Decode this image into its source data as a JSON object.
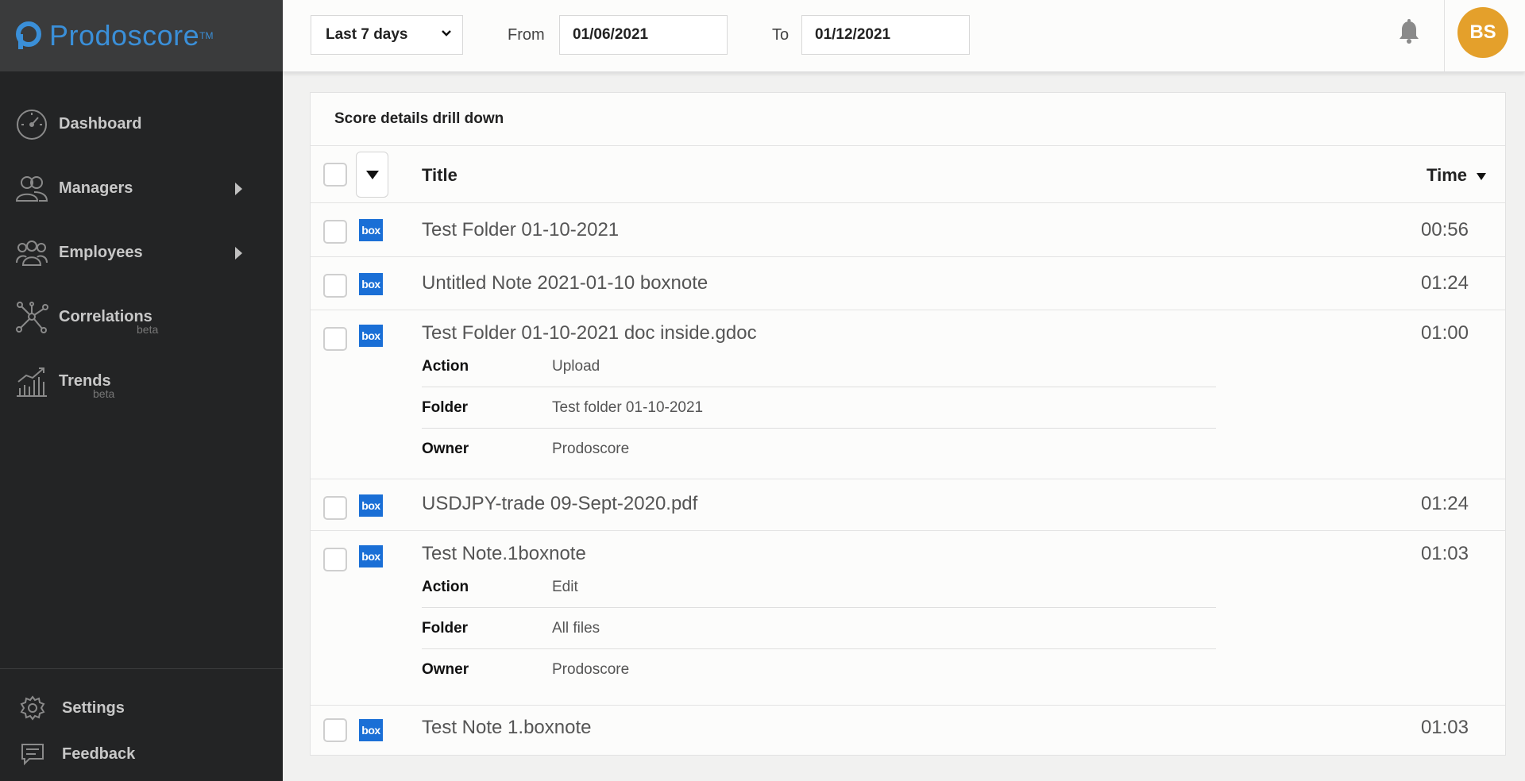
{
  "app": {
    "brand": "Prodoscore",
    "tm": "TM"
  },
  "colors": {
    "accent": "#3a8fd8",
    "avatar": "#e4a02b",
    "box": "#1a6fd6"
  },
  "sidebar": {
    "items": [
      {
        "label": "Dashboard",
        "icon": "speedometer-icon",
        "beta": "",
        "arrow": false
      },
      {
        "label": "Managers",
        "icon": "managers-icon",
        "beta": "",
        "arrow": true
      },
      {
        "label": "Employees",
        "icon": "employees-icon",
        "beta": "",
        "arrow": true
      },
      {
        "label": "Correlations",
        "icon": "network-icon",
        "beta": "beta",
        "arrow": false
      },
      {
        "label": "Trends",
        "icon": "trends-chart-icon",
        "beta": "beta",
        "arrow": false
      }
    ],
    "bottom": [
      {
        "label": "Settings",
        "icon": "gear-icon"
      },
      {
        "label": "Feedback",
        "icon": "feedback-icon"
      }
    ]
  },
  "header": {
    "range": "Last 7 days",
    "from_label": "From",
    "from_value": "01/06/2021",
    "to_label": "To",
    "to_value": "01/12/2021",
    "avatar_initials": "BS"
  },
  "card": {
    "title": "Score details drill down",
    "col_title": "Title",
    "col_time": "Time",
    "rows": [
      {
        "title": "Test Folder 01-10-2021",
        "time": "00:56",
        "source": "box",
        "details": []
      },
      {
        "title": "Untitled Note 2021-01-10 boxnote",
        "time": "01:24",
        "source": "box",
        "details": []
      },
      {
        "title": "Test Folder 01-10-2021 doc inside.gdoc",
        "time": "01:00",
        "source": "box",
        "details": [
          {
            "key": "Action",
            "value": "Upload"
          },
          {
            "key": "Folder",
            "value": "Test folder 01-10-2021"
          },
          {
            "key": "Owner",
            "value": "Prodoscore"
          }
        ]
      },
      {
        "title": "USDJPY-trade 09-Sept-2020.pdf",
        "time": "01:24",
        "source": "box",
        "details": []
      },
      {
        "title": "Test Note.1boxnote",
        "time": "01:03",
        "source": "box",
        "details": [
          {
            "key": "Action",
            "value": "Edit"
          },
          {
            "key": "Folder",
            "value": "All files"
          },
          {
            "key": "Owner",
            "value": "Prodoscore"
          }
        ]
      },
      {
        "title": "Test Note 1.boxnote",
        "time": "01:03",
        "source": "box",
        "details": []
      }
    ]
  }
}
